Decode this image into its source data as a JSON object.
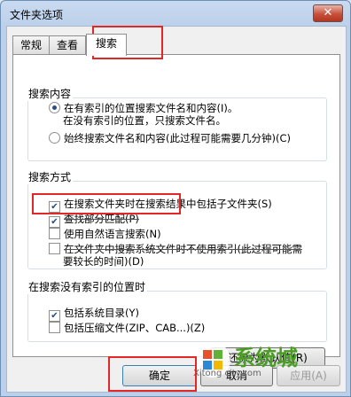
{
  "window": {
    "title": "文件夹选项",
    "close_symbol": "✕"
  },
  "tabs": [
    {
      "label": "常规"
    },
    {
      "label": "查看"
    },
    {
      "label": "搜索"
    }
  ],
  "search_content": {
    "label": "搜索内容",
    "option1_line1": "在有索引的位置搜索文件名和内容(I)。",
    "option1_line2": "在没有索引的位置，只搜索文件名。",
    "option2": "始终搜索文件名和内容(此过程可能需要几分钟)(C)"
  },
  "search_method": {
    "label": "搜索方式",
    "item1": "在搜索文件夹时在搜索结果中包括子文件夹(S)",
    "item2": "查找部分匹配(P)",
    "item3": "使用自然语言搜索(N)",
    "item4_line1": "在文件夹中搜索系统文件时不使用索引(此过程可能需",
    "item4_line2": "要较长的时间)(D)"
  },
  "no_index": {
    "label": "在搜索没有索引的位置时",
    "item1": "包括系统目录(Y)",
    "item2": "包括压缩文件(ZIP、CAB...)(Z)"
  },
  "buttons": {
    "restore": "还原为默认值(R)",
    "ok": "确定",
    "cancel": "取消",
    "apply": "应用(A)"
  },
  "watermark": {
    "brand": "系统城",
    "url": "Xitong city.com"
  },
  "colors": {
    "highlight": "#e32626",
    "accent": "#2a4f86"
  }
}
